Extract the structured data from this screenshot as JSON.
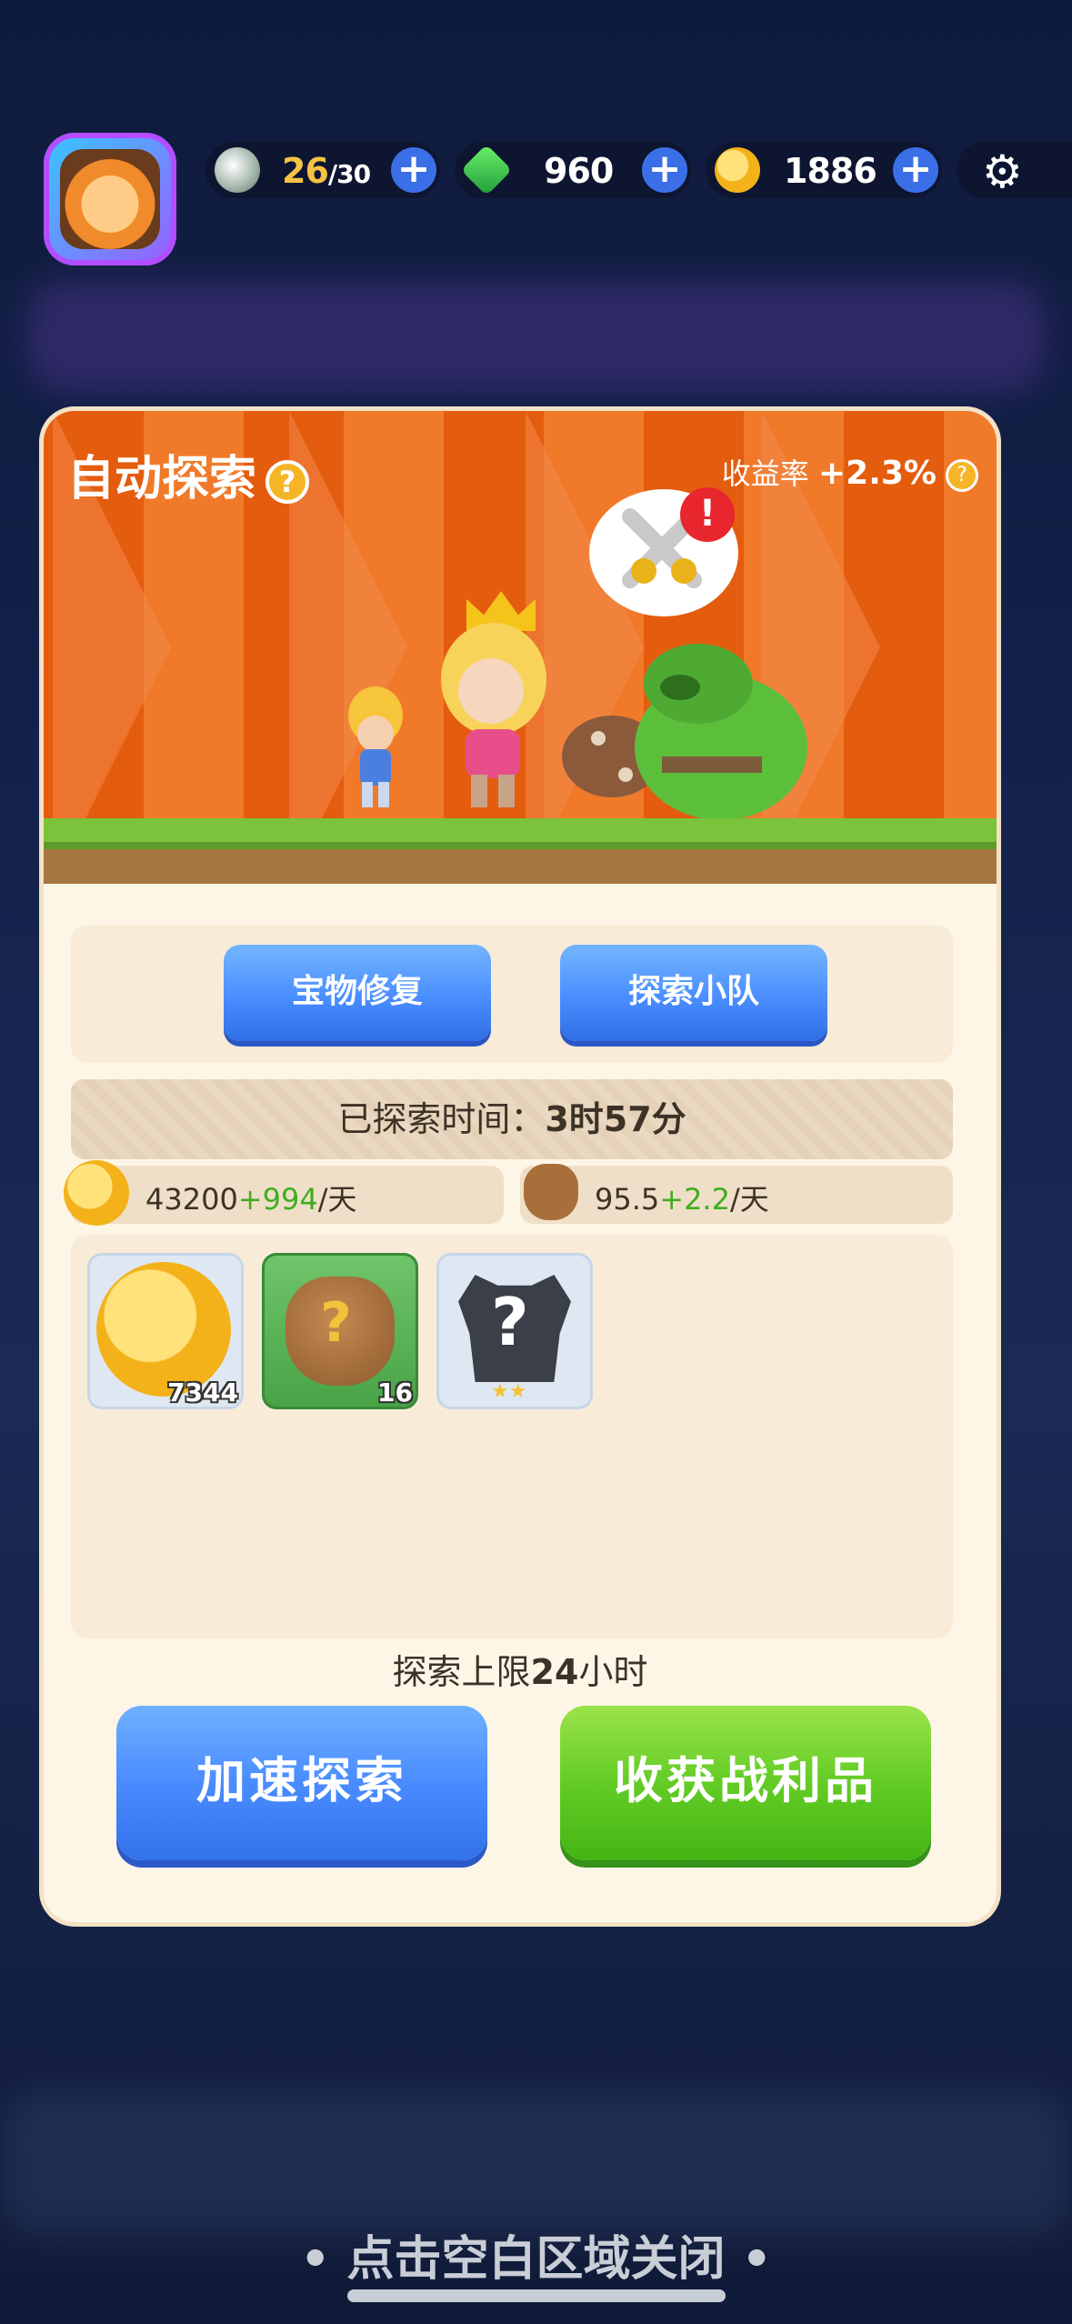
{
  "resources": {
    "energy": {
      "value": "26",
      "max": "/30",
      "icon": "gem-icon"
    },
    "gems": {
      "value": "960",
      "icon": "emerald-icon"
    },
    "coins": {
      "value": "1886",
      "icon": "coin-icon"
    },
    "plus_glyph": "+",
    "settings_glyph": "⚙"
  },
  "panel": {
    "title": "自动探索",
    "help_glyph": "?",
    "rate_label": "收益率",
    "rate_value": "+2.3%",
    "alert_glyph": "!",
    "buttons": {
      "repair": "宝物修复",
      "team": "探索小队"
    },
    "time_label": "已探索时间：",
    "time_value": "3时57分",
    "coin_rate": {
      "base": "43200",
      "bonus": "+994",
      "unit": "/天"
    },
    "bag_rate": {
      "base": "95.5",
      "bonus": "+2.2",
      "unit": "/天"
    },
    "rewards": [
      {
        "name": "coin",
        "count": "7344"
      },
      {
        "name": "mystery-bag",
        "count": "16"
      },
      {
        "name": "mystery-armor",
        "stars": "★★"
      }
    ],
    "limit_prefix": "探索上限",
    "limit_value": "24",
    "limit_suffix": "小时",
    "accelerate": "加速探索",
    "collect": "收获战利品",
    "q_glyph": "?"
  },
  "close_hint": "• 点击空白区域关闭 •",
  "colors": {
    "accent_blue": "#4a8dff",
    "accent_green": "#63cc25",
    "scene_orange": "#e45c0e"
  }
}
